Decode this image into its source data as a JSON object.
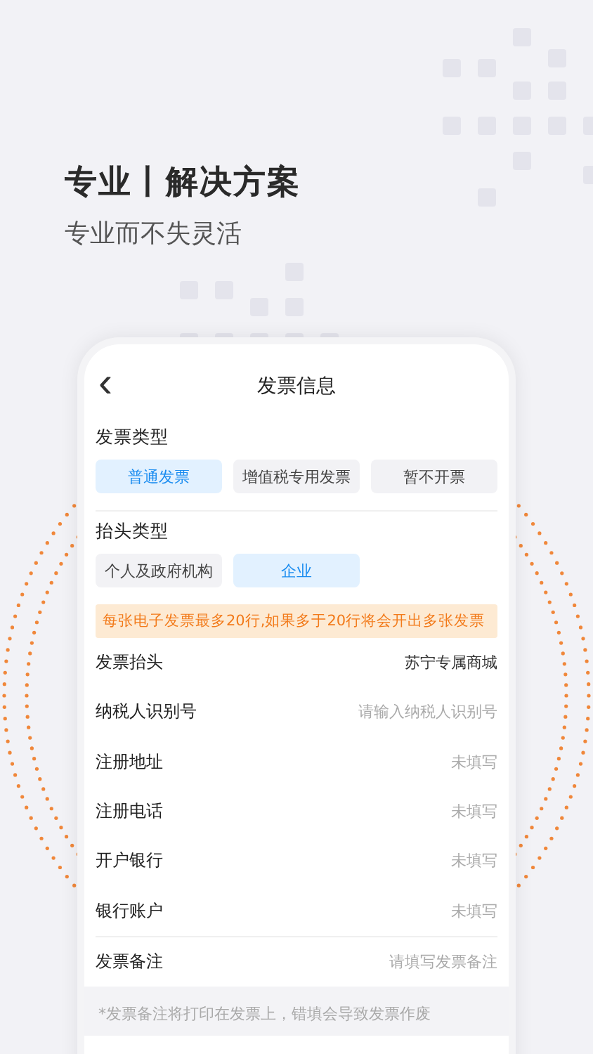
{
  "headline": "专业丨解决方案",
  "subtitle": "专业而不失灵活",
  "screen": {
    "back": "‹",
    "title": "发票信息",
    "invoice_type": {
      "label": "发票类型",
      "options": [
        {
          "label": "普通发票",
          "selected": true
        },
        {
          "label": "增值税专用发票",
          "selected": false
        },
        {
          "label": "暂不开票",
          "selected": false
        }
      ]
    },
    "title_type": {
      "label": "抬头类型",
      "options": [
        {
          "label": "个人及政府机构",
          "selected": false
        },
        {
          "label": "企业",
          "selected": true
        }
      ]
    },
    "notice": "每张电子发票最多20行,如果多于20行将会开出多张发票",
    "fields": [
      {
        "label": "发票抬头",
        "value": "苏宁专属商城"
      },
      {
        "label": "纳税人识别号",
        "placeholder": "请输入纳税人识别号"
      },
      {
        "label": "注册地址",
        "placeholder": "未填写"
      },
      {
        "label": "注册电话",
        "placeholder": "未填写"
      },
      {
        "label": "开户银行",
        "placeholder": "未填写"
      },
      {
        "label": "银行账户",
        "placeholder": "未填写"
      }
    ],
    "remark": {
      "label": "发票备注",
      "placeholder": "请填写发票备注"
    },
    "footnote": "*发票备注将打印在发票上，错填会导致发票作废"
  }
}
